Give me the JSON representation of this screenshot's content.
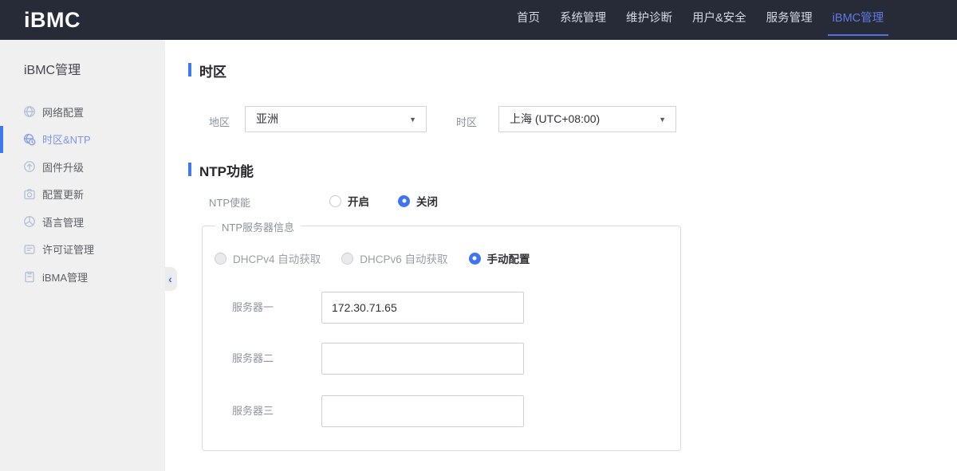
{
  "topbar": {
    "logo": "iBMC",
    "nav": [
      {
        "label": "首页",
        "active": false
      },
      {
        "label": "系统管理",
        "active": false
      },
      {
        "label": "维护诊断",
        "active": false
      },
      {
        "label": "用户&安全",
        "active": false
      },
      {
        "label": "服务管理",
        "active": false
      },
      {
        "label": "iBMC管理",
        "active": true
      }
    ]
  },
  "sidebar": {
    "title": "iBMC管理",
    "items": [
      {
        "label": "网络配置",
        "icon": "network-icon",
        "active": false
      },
      {
        "label": "时区&NTP",
        "icon": "timezone-ntp-icon",
        "active": true
      },
      {
        "label": "固件升级",
        "icon": "firmware-upgrade-icon",
        "active": false
      },
      {
        "label": "配置更新",
        "icon": "config-update-icon",
        "active": false
      },
      {
        "label": "语言管理",
        "icon": "language-icon",
        "active": false
      },
      {
        "label": "许可证管理",
        "icon": "license-icon",
        "active": false
      },
      {
        "label": "iBMA管理",
        "icon": "ibma-icon",
        "active": false
      }
    ],
    "collapse_icon": "‹"
  },
  "icons": {
    "caret": "▼"
  },
  "main": {
    "timezone_section": {
      "title": "时区",
      "region": {
        "label": "地区",
        "value": "亚洲"
      },
      "timezone": {
        "label": "时区",
        "value": "上海 (UTC+08:00)"
      }
    },
    "ntp_section": {
      "title": "NTP功能",
      "enable": {
        "label": "NTP使能",
        "options": [
          {
            "label": "开启",
            "selected": false
          },
          {
            "label": "关闭",
            "selected": true
          }
        ]
      },
      "server_group": {
        "legend": "NTP服务器信息",
        "modes": [
          {
            "label": "DHCPv4 自动获取",
            "selected": false,
            "disabled": true
          },
          {
            "label": "DHCPv6 自动获取",
            "selected": false,
            "disabled": true
          },
          {
            "label": "手动配置",
            "selected": true,
            "disabled": false
          }
        ],
        "servers": [
          {
            "label": "服务器一",
            "value": "172.30.71.65"
          },
          {
            "label": "服务器二",
            "value": ""
          },
          {
            "label": "服务器三",
            "value": ""
          }
        ]
      }
    }
  },
  "colors": {
    "topbar_bg": "#272b37",
    "accent_blue": "#3f75f2",
    "nav_active_blue": "#5d7ae2",
    "sidebar_bg": "#f0f0f1",
    "sidebar_active_text": "#7e96ed"
  }
}
